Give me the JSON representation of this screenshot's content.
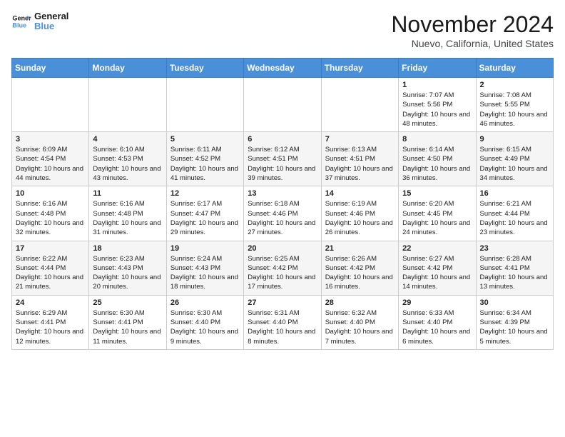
{
  "header": {
    "logo_line1": "General",
    "logo_line2": "Blue",
    "month": "November 2024",
    "location": "Nuevo, California, United States"
  },
  "weekdays": [
    "Sunday",
    "Monday",
    "Tuesday",
    "Wednesday",
    "Thursday",
    "Friday",
    "Saturday"
  ],
  "weeks": [
    [
      {
        "day": "",
        "info": ""
      },
      {
        "day": "",
        "info": ""
      },
      {
        "day": "",
        "info": ""
      },
      {
        "day": "",
        "info": ""
      },
      {
        "day": "",
        "info": ""
      },
      {
        "day": "1",
        "info": "Sunrise: 7:07 AM\nSunset: 5:56 PM\nDaylight: 10 hours and 48 minutes."
      },
      {
        "day": "2",
        "info": "Sunrise: 7:08 AM\nSunset: 5:55 PM\nDaylight: 10 hours and 46 minutes."
      }
    ],
    [
      {
        "day": "3",
        "info": "Sunrise: 6:09 AM\nSunset: 4:54 PM\nDaylight: 10 hours and 44 minutes."
      },
      {
        "day": "4",
        "info": "Sunrise: 6:10 AM\nSunset: 4:53 PM\nDaylight: 10 hours and 43 minutes."
      },
      {
        "day": "5",
        "info": "Sunrise: 6:11 AM\nSunset: 4:52 PM\nDaylight: 10 hours and 41 minutes."
      },
      {
        "day": "6",
        "info": "Sunrise: 6:12 AM\nSunset: 4:51 PM\nDaylight: 10 hours and 39 minutes."
      },
      {
        "day": "7",
        "info": "Sunrise: 6:13 AM\nSunset: 4:51 PM\nDaylight: 10 hours and 37 minutes."
      },
      {
        "day": "8",
        "info": "Sunrise: 6:14 AM\nSunset: 4:50 PM\nDaylight: 10 hours and 36 minutes."
      },
      {
        "day": "9",
        "info": "Sunrise: 6:15 AM\nSunset: 4:49 PM\nDaylight: 10 hours and 34 minutes."
      }
    ],
    [
      {
        "day": "10",
        "info": "Sunrise: 6:16 AM\nSunset: 4:48 PM\nDaylight: 10 hours and 32 minutes."
      },
      {
        "day": "11",
        "info": "Sunrise: 6:16 AM\nSunset: 4:48 PM\nDaylight: 10 hours and 31 minutes."
      },
      {
        "day": "12",
        "info": "Sunrise: 6:17 AM\nSunset: 4:47 PM\nDaylight: 10 hours and 29 minutes."
      },
      {
        "day": "13",
        "info": "Sunrise: 6:18 AM\nSunset: 4:46 PM\nDaylight: 10 hours and 27 minutes."
      },
      {
        "day": "14",
        "info": "Sunrise: 6:19 AM\nSunset: 4:46 PM\nDaylight: 10 hours and 26 minutes."
      },
      {
        "day": "15",
        "info": "Sunrise: 6:20 AM\nSunset: 4:45 PM\nDaylight: 10 hours and 24 minutes."
      },
      {
        "day": "16",
        "info": "Sunrise: 6:21 AM\nSunset: 4:44 PM\nDaylight: 10 hours and 23 minutes."
      }
    ],
    [
      {
        "day": "17",
        "info": "Sunrise: 6:22 AM\nSunset: 4:44 PM\nDaylight: 10 hours and 21 minutes."
      },
      {
        "day": "18",
        "info": "Sunrise: 6:23 AM\nSunset: 4:43 PM\nDaylight: 10 hours and 20 minutes."
      },
      {
        "day": "19",
        "info": "Sunrise: 6:24 AM\nSunset: 4:43 PM\nDaylight: 10 hours and 18 minutes."
      },
      {
        "day": "20",
        "info": "Sunrise: 6:25 AM\nSunset: 4:42 PM\nDaylight: 10 hours and 17 minutes."
      },
      {
        "day": "21",
        "info": "Sunrise: 6:26 AM\nSunset: 4:42 PM\nDaylight: 10 hours and 16 minutes."
      },
      {
        "day": "22",
        "info": "Sunrise: 6:27 AM\nSunset: 4:42 PM\nDaylight: 10 hours and 14 minutes."
      },
      {
        "day": "23",
        "info": "Sunrise: 6:28 AM\nSunset: 4:41 PM\nDaylight: 10 hours and 13 minutes."
      }
    ],
    [
      {
        "day": "24",
        "info": "Sunrise: 6:29 AM\nSunset: 4:41 PM\nDaylight: 10 hours and 12 minutes."
      },
      {
        "day": "25",
        "info": "Sunrise: 6:30 AM\nSunset: 4:41 PM\nDaylight: 10 hours and 11 minutes."
      },
      {
        "day": "26",
        "info": "Sunrise: 6:30 AM\nSunset: 4:40 PM\nDaylight: 10 hours and 9 minutes."
      },
      {
        "day": "27",
        "info": "Sunrise: 6:31 AM\nSunset: 4:40 PM\nDaylight: 10 hours and 8 minutes."
      },
      {
        "day": "28",
        "info": "Sunrise: 6:32 AM\nSunset: 4:40 PM\nDaylight: 10 hours and 7 minutes."
      },
      {
        "day": "29",
        "info": "Sunrise: 6:33 AM\nSunset: 4:40 PM\nDaylight: 10 hours and 6 minutes."
      },
      {
        "day": "30",
        "info": "Sunrise: 6:34 AM\nSunset: 4:39 PM\nDaylight: 10 hours and 5 minutes."
      }
    ]
  ]
}
